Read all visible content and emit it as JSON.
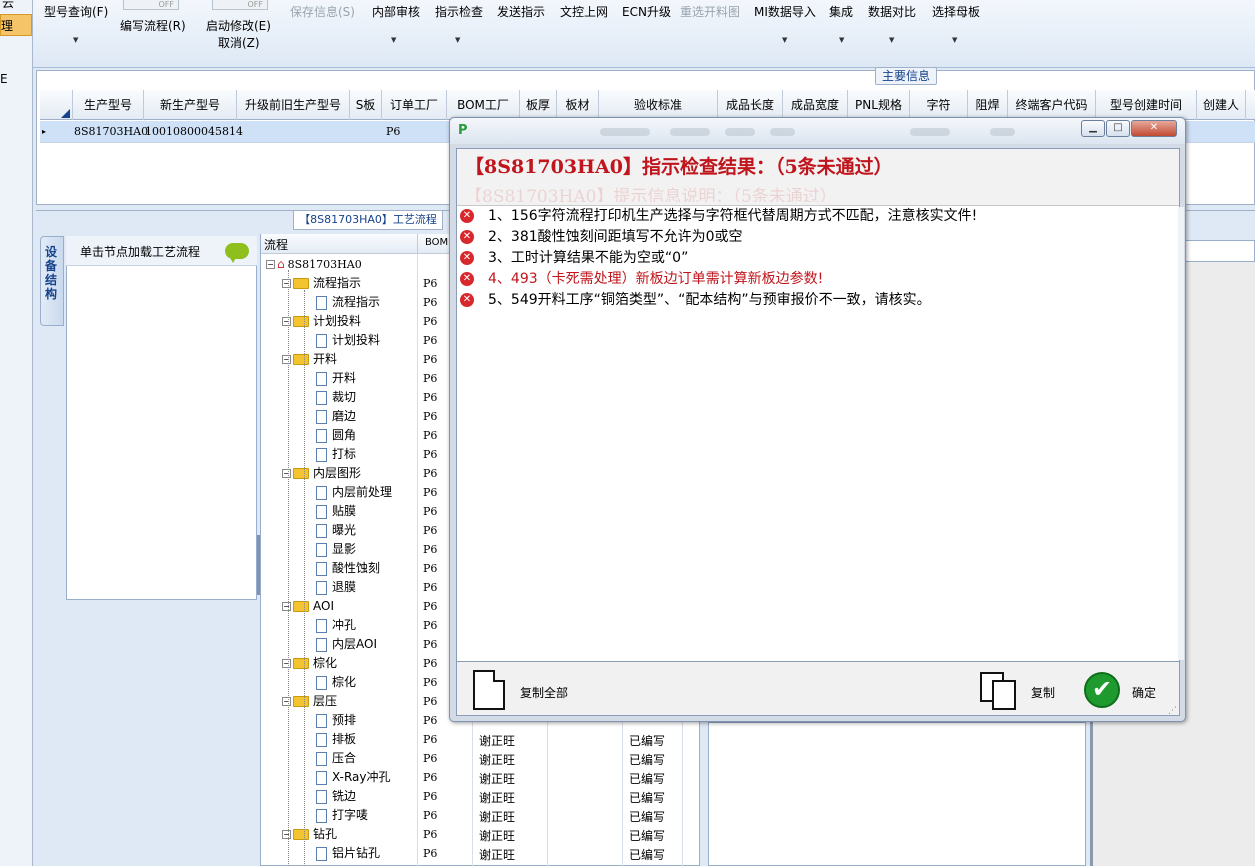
{
  "left_strip": {
    "items": [
      "云",
      "理",
      "E"
    ]
  },
  "toolbar": {
    "buttons": [
      {
        "label": "型号查询(F)",
        "dropdown": true,
        "disabled": false
      },
      {
        "label": "编写流程(R)",
        "dropdown": false,
        "disabled": false
      },
      {
        "label": "启动修改(E)",
        "dropdown": false,
        "disabled": false
      },
      {
        "label": "取消(Z)",
        "dropdown": false,
        "disabled": false
      },
      {
        "label": "保存信息(S)",
        "dropdown": false,
        "disabled": true
      },
      {
        "label": "内部审核",
        "dropdown": true,
        "disabled": false
      },
      {
        "label": "指示检查",
        "dropdown": true,
        "disabled": false
      },
      {
        "label": "发送指示",
        "dropdown": false,
        "disabled": false
      },
      {
        "label": "文控上网",
        "dropdown": false,
        "disabled": false
      },
      {
        "label": "ECN升级",
        "dropdown": false,
        "disabled": false
      },
      {
        "label": "重选开料图",
        "dropdown": false,
        "disabled": true
      },
      {
        "label": "MI数据导入",
        "dropdown": true,
        "disabled": false
      },
      {
        "label": "集成",
        "dropdown": true,
        "disabled": false
      },
      {
        "label": "数据对比",
        "dropdown": true,
        "disabled": false
      },
      {
        "label": "选择母板",
        "dropdown": true,
        "disabled": false
      }
    ],
    "toggle_off": "OFF"
  },
  "main_info": {
    "title": "主要信息",
    "columns": [
      "生产型号",
      "新生产型号",
      "升级前旧生产型号",
      "S板",
      "订单工厂",
      "BOM工厂",
      "板厚",
      "板材",
      "验收标准",
      "成品长度",
      "成品宽度",
      "PNL规格",
      "字符",
      "阻焊",
      "终端客户代码",
      "型号创建时间",
      "创建人"
    ],
    "row": {
      "selector": "▸",
      "model": "8S81703HA0",
      "new_model": "10010800045814",
      "order_factory": "P6"
    }
  },
  "lower": {
    "title": "【8S81703HA0】工艺流程",
    "vertical_tab": "设备结构",
    "node_panel_header": "单击节点加载工艺流程",
    "flow_header": {
      "col1": "流程",
      "col2": "BOM"
    },
    "tree_root": "8S81703HA0",
    "tree": [
      {
        "label": "流程指示",
        "level": 1,
        "factory": "P6"
      },
      {
        "label": "流程指示",
        "level": 2,
        "factory": "P6"
      },
      {
        "label": "计划投料",
        "level": 1,
        "factory": "P6"
      },
      {
        "label": "计划投料",
        "level": 2,
        "factory": "P6"
      },
      {
        "label": "开料",
        "level": 1,
        "factory": "P6"
      },
      {
        "label": "开料",
        "level": 2,
        "factory": "P6"
      },
      {
        "label": "裁切",
        "level": 2,
        "factory": "P6"
      },
      {
        "label": "磨边",
        "level": 2,
        "factory": "P6"
      },
      {
        "label": "圆角",
        "level": 2,
        "factory": "P6"
      },
      {
        "label": "打标",
        "level": 2,
        "factory": "P6"
      },
      {
        "label": "内层图形",
        "level": 1,
        "factory": "P6"
      },
      {
        "label": "内层前处理",
        "level": 2,
        "factory": "P6"
      },
      {
        "label": "贴膜",
        "level": 2,
        "factory": "P6"
      },
      {
        "label": "曝光",
        "level": 2,
        "factory": "P6"
      },
      {
        "label": "显影",
        "level": 2,
        "factory": "P6"
      },
      {
        "label": "酸性蚀刻",
        "level": 2,
        "factory": "P6"
      },
      {
        "label": "退膜",
        "level": 2,
        "factory": "P6"
      },
      {
        "label": "AOI",
        "level": 1,
        "factory": "P6"
      },
      {
        "label": "冲孔",
        "level": 2,
        "factory": "P6"
      },
      {
        "label": "内层AOI",
        "level": 2,
        "factory": "P6"
      },
      {
        "label": "棕化",
        "level": 1,
        "factory": "P6"
      },
      {
        "label": "棕化",
        "level": 2,
        "factory": "P6"
      },
      {
        "label": "层压",
        "level": 1,
        "factory": "P6"
      },
      {
        "label": "预排",
        "level": 2,
        "factory": "P6",
        "author": "谢正旺",
        "status": "已编写"
      },
      {
        "label": "排板",
        "level": 2,
        "factory": "P6",
        "author": "谢正旺",
        "status": "已编写"
      },
      {
        "label": "压合",
        "level": 2,
        "factory": "P6",
        "author": "谢正旺",
        "status": "已编写"
      },
      {
        "label": "X-Ray冲孔",
        "level": 2,
        "factory": "P6",
        "author": "谢正旺",
        "status": "已编写"
      },
      {
        "label": "铣边",
        "level": 2,
        "factory": "P6",
        "author": "谢正旺",
        "status": "已编写"
      },
      {
        "label": "打字唛",
        "level": 2,
        "factory": "P6",
        "author": "谢正旺",
        "status": "已编写"
      },
      {
        "label": "钻孔",
        "level": 1,
        "factory": "P6",
        "author": "谢正旺",
        "status": "已编写"
      },
      {
        "label": "铝片钻孔",
        "level": 2,
        "factory": "P6",
        "author": "谢正旺",
        "status": "已编写"
      }
    ]
  },
  "dialog": {
    "window_buttons": {
      "minimize": "▁",
      "maximize": "□",
      "close": "✕"
    },
    "heading": "【8S81703HA0】指示检查结果：（5条未通过）",
    "ghost_heading": "【8S81703HA0】提示信息说明：（5条未通过）",
    "messages": [
      {
        "text": "1、156字符流程打印机生产选择与字符框代替周期方式不匹配，注意核实文件!",
        "color": "#000000"
      },
      {
        "text": "2、381酸性蚀刻间距填写不允许为0或空",
        "color": "#000000"
      },
      {
        "text": "3、工时计算结果不能为空或“0”",
        "color": "#000000"
      },
      {
        "text": "4、493（卡死需处理）新板边订单需计算新板边参数!",
        "color": "#c0151c"
      },
      {
        "text": "5、549开料工序“铜箔类型”、“配本结构”与预审报价不一致，请核实。",
        "color": "#000000"
      }
    ],
    "error_icon": "✕",
    "copy_all_label": "复制全部",
    "copy_label": "复制",
    "ok_label": "确定",
    "ok_icon": "✔"
  },
  "colors": {
    "accent": "#15428b",
    "error": "#d6282d",
    "heading": "#c0151c",
    "ok": "#1f9a2e",
    "row_selected": "#cfe1f7"
  }
}
